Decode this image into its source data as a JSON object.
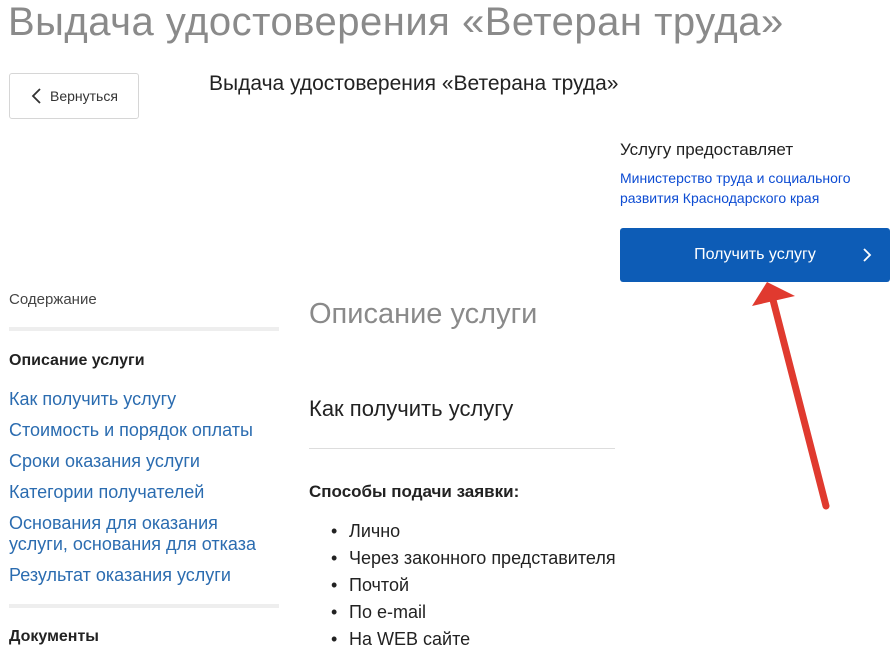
{
  "page": {
    "title": "Выдача удостоверения «Ветеран труда»"
  },
  "back_button": {
    "label": "Вернуться"
  },
  "service": {
    "heading": "Выдача удостоверения «Ветерана труда»"
  },
  "provider": {
    "title": "Услугу предоставляет",
    "link": "Министерство труда и социального развития Краснодарского края"
  },
  "cta": {
    "label": "Получить услугу"
  },
  "toc": {
    "title": "Содержание",
    "active": "Описание услуги",
    "items": [
      {
        "label": "Как получить услугу"
      },
      {
        "label": "Стоимость и порядок оплаты"
      },
      {
        "label": "Сроки оказания услуги"
      },
      {
        "label": "Категории получателей"
      },
      {
        "label": "Основания для оказания услуги, основания для отказа"
      },
      {
        "label": "Результат оказания услуги"
      }
    ],
    "documents": "Документы"
  },
  "content": {
    "section_title": "Описание услуги",
    "subsection_title": "Как получить услугу",
    "methods_title": "Способы подачи заявки:",
    "methods": [
      {
        "label": "Лично"
      },
      {
        "label": "Через законного представителя"
      },
      {
        "label": "Почтой"
      },
      {
        "label": "По e-mail"
      },
      {
        "label": "На WEB сайте"
      }
    ]
  },
  "colors": {
    "accent": "#0d5cb6",
    "link": "#2b6cb0",
    "annotation_arrow": "#e03a2f"
  },
  "icons": {
    "back": "chevron-left-icon",
    "cta": "chevron-right-icon"
  }
}
